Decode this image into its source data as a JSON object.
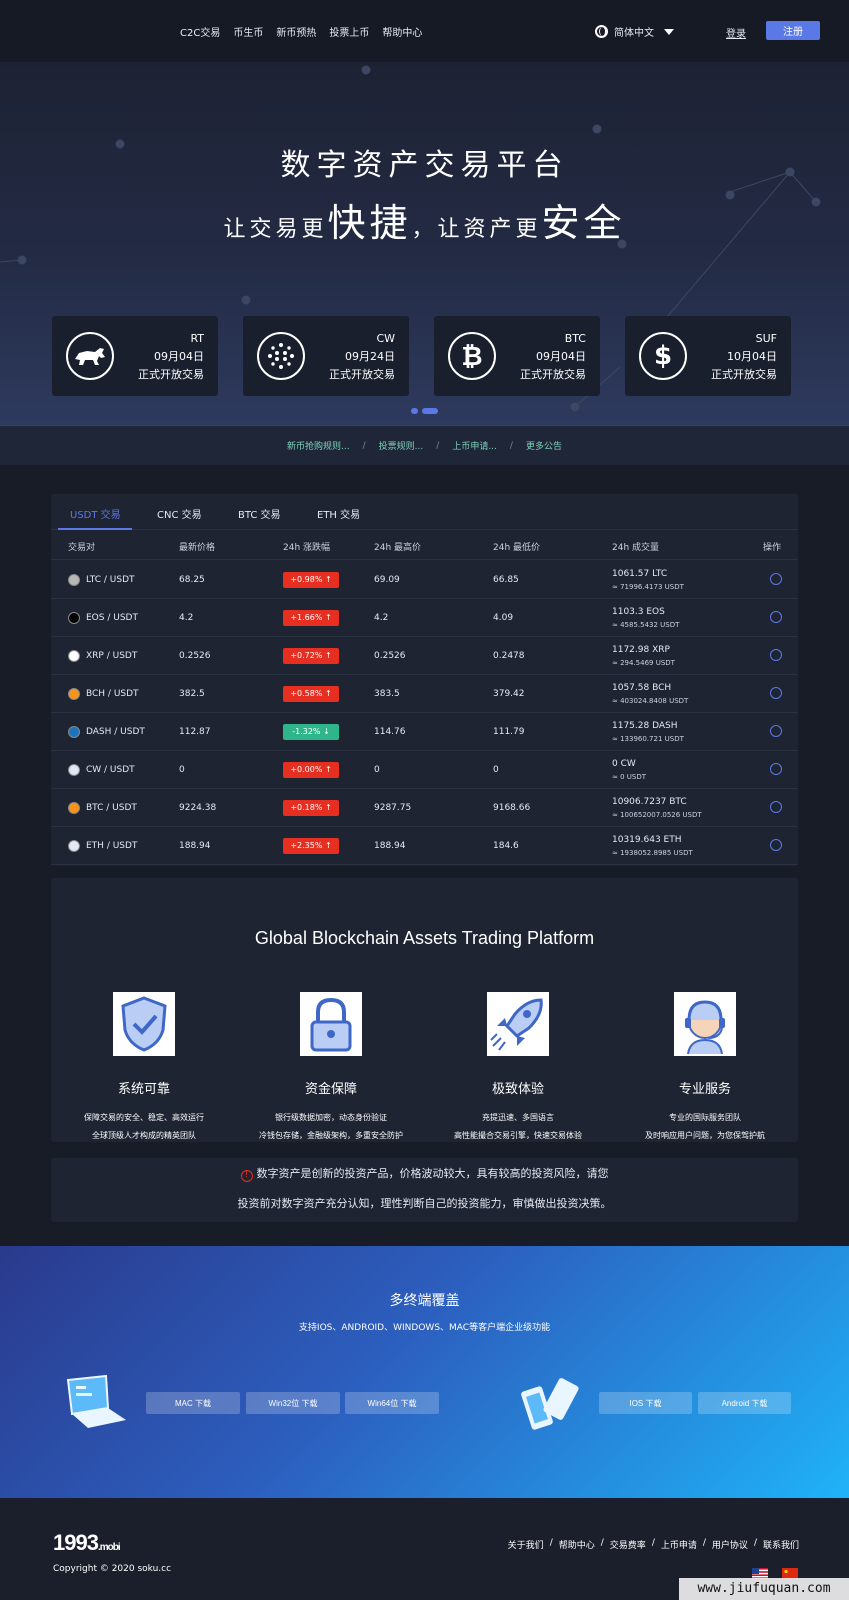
{
  "header": {
    "nav": [
      "C2C交易",
      "币生币",
      "新币预热",
      "投票上币",
      "帮助中心"
    ],
    "language": "简体中文",
    "login": "登录",
    "register": "注册"
  },
  "hero": {
    "title": "数字资产交易平台",
    "sub_prefix1": "让交易更",
    "sub_big1": "快捷",
    "sub_comma": "，",
    "sub_prefix2": "让资产更",
    "sub_big2": "安全"
  },
  "coins": [
    {
      "name": "RT",
      "date": "09月04日",
      "status": "正式开放交易",
      "icon": "bull-icon"
    },
    {
      "name": "CW",
      "date": "09月24日",
      "status": "正式开放交易",
      "icon": "network-icon"
    },
    {
      "name": "BTC",
      "date": "09月04日",
      "status": "正式开放交易",
      "icon": "bitcoin-icon",
      "symbol": "₿"
    },
    {
      "name": "SUF",
      "date": "10月04日",
      "status": "正式开放交易",
      "icon": "dollar-coin-icon",
      "symbol": "$"
    }
  ],
  "notices": [
    "新币抢购规则...",
    "投票规则...",
    "上币申请...",
    "更多公告"
  ],
  "market": {
    "tabs": [
      "USDT 交易",
      "CNC 交易",
      "BTC 交易",
      "ETH 交易"
    ],
    "active_tab": 0,
    "columns": [
      "交易对",
      "最新价格",
      "24h 涨跌幅",
      "24h 最高价",
      "24h 最低价",
      "24h 成交量",
      "操作"
    ],
    "rows": [
      {
        "pair": "LTC / USDT",
        "price": "68.25",
        "change": "+0.98%",
        "dir": "up",
        "high": "69.09",
        "low": "66.85",
        "vol": "1061.57 LTC",
        "vol_usdt": "≈ 71996.4173 USDT",
        "icon_color": "#b8b8b8"
      },
      {
        "pair": "EOS / USDT",
        "price": "4.2",
        "change": "+1.66%",
        "dir": "up",
        "high": "4.2",
        "low": "4.09",
        "vol": "1103.3 EOS",
        "vol_usdt": "≈ 4585.5432 USDT",
        "icon_color": "#000000"
      },
      {
        "pair": "XRP / USDT",
        "price": "0.2526",
        "change": "+0.72%",
        "dir": "up",
        "high": "0.2526",
        "low": "0.2478",
        "vol": "1172.98 XRP",
        "vol_usdt": "≈ 294.5469 USDT",
        "icon_color": "#ffffff"
      },
      {
        "pair": "BCH / USDT",
        "price": "382.5",
        "change": "+0.58%",
        "dir": "up",
        "high": "383.5",
        "low": "379.42",
        "vol": "1057.58 BCH",
        "vol_usdt": "≈ 403024.8408 USDT",
        "icon_color": "#f7941d"
      },
      {
        "pair": "DASH / USDT",
        "price": "112.87",
        "change": "-1.32%",
        "dir": "down",
        "high": "114.76",
        "low": "111.79",
        "vol": "1175.28 DASH",
        "vol_usdt": "≈ 133960.721 USDT",
        "icon_color": "#1c75bc"
      },
      {
        "pair": "CW / USDT",
        "price": "0",
        "change": "+0.00%",
        "dir": "up",
        "high": "0",
        "low": "0",
        "vol": "0 CW",
        "vol_usdt": "≈ 0 USDT",
        "icon_color": "#dfe8f5"
      },
      {
        "pair": "BTC / USDT",
        "price": "9224.38",
        "change": "+0.18%",
        "dir": "up",
        "high": "9287.75",
        "low": "9168.66",
        "vol": "10906.7237 BTC",
        "vol_usdt": "≈ 100652007.0526 USDT",
        "icon_color": "#f7931a"
      },
      {
        "pair": "ETH / USDT",
        "price": "188.94",
        "change": "+2.35%",
        "dir": "up",
        "high": "188.94",
        "low": "184.6",
        "vol": "10319.643 ETH",
        "vol_usdt": "≈ 1938052.8985 USDT",
        "icon_color": "#e5e9f5"
      }
    ]
  },
  "features": {
    "title": "Global Blockchain Assets Trading Platform",
    "items": [
      {
        "title": "系统可靠",
        "desc1": "保障交易的安全、稳定、高效运行",
        "desc2": "全球顶级人才构成的精英团队",
        "icon": "shield-check-icon"
      },
      {
        "title": "资金保障",
        "desc1": "银行级数据加密，动态身份验证",
        "desc2": "冷钱包存储，金融级架构，多重安全防护",
        "icon": "padlock-icon"
      },
      {
        "title": "极致体验",
        "desc1": "充提迅速、多国语言",
        "desc2": "高性能撮合交易引擎，快速交易体验",
        "icon": "rocket-icon"
      },
      {
        "title": "专业服务",
        "desc1": "专业的国际服务团队",
        "desc2": "及时响应用户问题，为您保驾护航",
        "icon": "support-agent-icon"
      }
    ]
  },
  "risk": {
    "line1": "数字资产是创新的投资产品，价格波动较大，具有较高的投资风险，请您",
    "line2": "投资前对数字资产充分认知，理性判断自己的投资能力，审慎做出投资决策。"
  },
  "download": {
    "title": "多终端覆盖",
    "subtitle": "支持IOS、ANDROID、WINDOWS、MAC等客户端企业级功能",
    "desktop_buttons": [
      "MAC 下载",
      "Win32位 下载",
      "Win64位 下载"
    ],
    "mobile_buttons": [
      "IOS 下载",
      "Android 下载"
    ]
  },
  "footer": {
    "brand": "1993",
    "brand_suffix": ".mobi",
    "copyright": "Copyright © 2020 soku.cc",
    "links": [
      "关于我们",
      "帮助中心",
      "交易费率",
      "上币申请",
      "用户协议",
      "联系我们"
    ],
    "watermark": "www.jiufuquan.com"
  },
  "colors": {
    "accent": "#5a79e6",
    "up": "#e62f20",
    "down": "#2fb58a",
    "notice_link": "#7dd3b9"
  }
}
